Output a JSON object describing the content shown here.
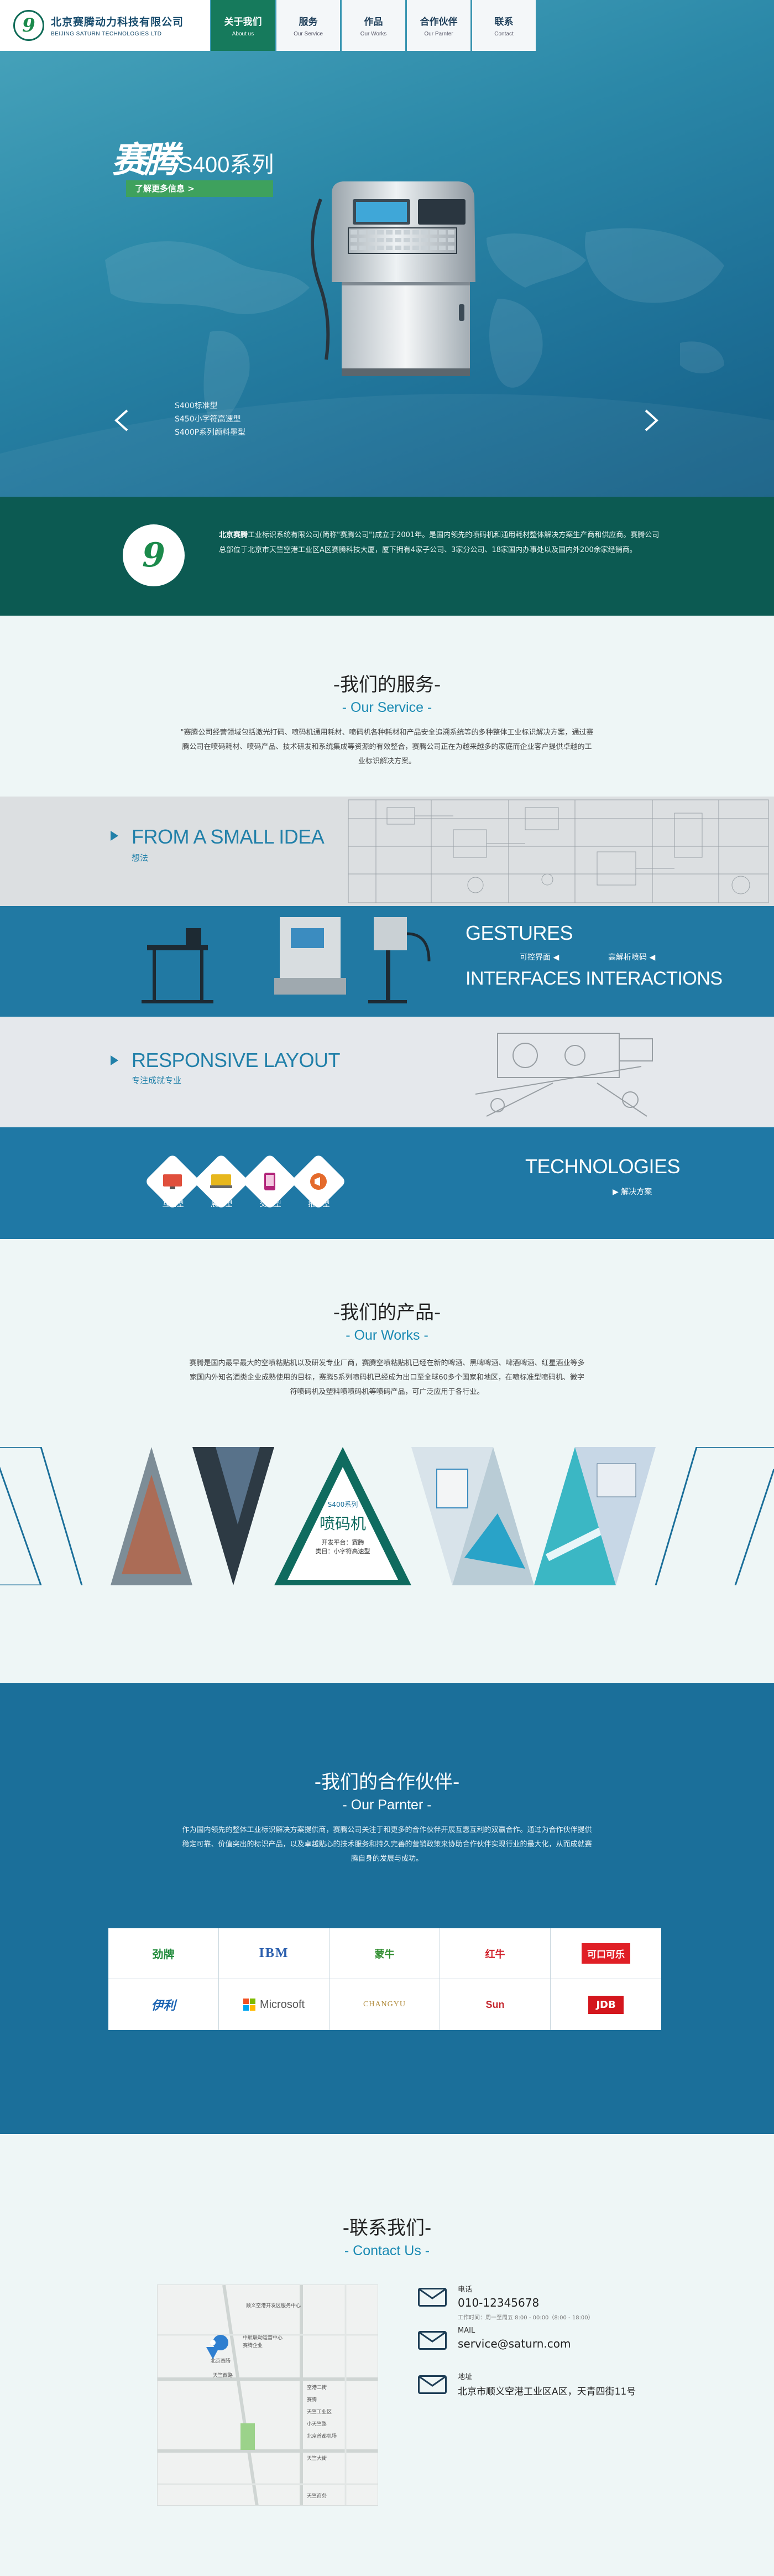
{
  "header": {
    "company_cn": "北京赛腾动力科技有限公司",
    "company_en": "BEIJING SATURN TECHNOLOGIES LTD",
    "nav": [
      {
        "cn": "关于我们",
        "en": "About us",
        "active": true
      },
      {
        "cn": "服务",
        "en": "Our Service",
        "active": false
      },
      {
        "cn": "作品",
        "en": "Our Works",
        "active": false
      },
      {
        "cn": "合作伙伴",
        "en": "Our Parnter",
        "active": false
      },
      {
        "cn": "联系",
        "en": "Contact",
        "active": false
      }
    ]
  },
  "hero": {
    "brand": "赛腾",
    "model": "S400系列",
    "button": "了解更多信息 >",
    "list": [
      "S400标准型",
      "S450小字符高速型",
      "S400P系列颜料墨型"
    ]
  },
  "intro": {
    "lead": "北京赛腾",
    "text": "工业标识系统有限公司(简称\"赛腾公司\")成立于2001年。是国内领先的喷码机和通用耗材整体解决方案生产商和供应商。赛腾公司总部位于北京市天竺空港工业区A区赛腾科技大厦，厦下拥有4家子公司、3家分公司、18家国内办事处以及国内外200余家经销商。"
  },
  "service": {
    "title_cn": "我们的服务",
    "title_en": "Our Service",
    "desc": "\"赛腾公司经营领域包括激光打码、喷码机通用耗材、喷码机各种耗材和产品安全追溯系统等的多种整体工业标识解决方案，通过赛腾公司在喷码耗材、喷码产品、技术研发和系统集成等资源的有效整合，赛腾公司正在为越来越多的家庭而企业客户提供卓越的工业标识解决方案。",
    "stripe1": {
      "head": "FROM A SMALL IDEA",
      "sub": "想法"
    },
    "stripe2": {
      "head1": "GESTURES",
      "head2": "INTERFACES INTERACTIONS",
      "tag1": "可控界面",
      "tag2": "高解析喷码"
    },
    "stripe3": {
      "head": "RESPONSIVE LAYOUT",
      "sub": "专注成就专业"
    },
    "stripe4": {
      "head": "TECHNOLOGIES",
      "sub": "解决方案",
      "icons": [
        {
          "label": "互动型",
          "icon": "display-icon",
          "color": "#e04f3c"
        },
        {
          "label": "展示型",
          "icon": "monitor-icon",
          "color": "#e7b71d"
        },
        {
          "label": "交互型",
          "icon": "phone-icon",
          "color": "#b2247a"
        },
        {
          "label": "推广型",
          "icon": "megaphone-icon",
          "color": "#e46a2b"
        }
      ]
    }
  },
  "works": {
    "title_cn": "我们的产品",
    "title_en": "Our Works",
    "desc": "赛腾是国内最早最大的空喷粘贴机以及研发专业厂商，赛腾空喷粘贴机已经在新的啤酒、黑啤啤酒、啤酒啤酒、红星酒业等多家国内外知名酒类企业成熟使用的目标，赛腾S系列喷码机已经成为出口至全球60多个国家和地区，在喷标准型喷码机、微字符喷码机及塑料喷喷码机等喷码产品，可广泛应用于各行业。",
    "feature": {
      "series": "S400系列",
      "name": "喷码机",
      "line1": "开发平台：赛腾",
      "line2": "类目：小字符高速型"
    }
  },
  "partners": {
    "title_cn": "我们的合作伙伴",
    "title_en": "Our Parnter",
    "desc": "作为国内领先的整体工业标识解决方案提供商，赛腾公司关注于和更多的合作伙伴开展互惠互利的双赢合作。通过为合作伙伴提供稳定可靠、价值突出的标识产品，以及卓越贴心的技术服务和持久完善的营销政策来协助合作伙伴实现行业的最大化，从而成就赛腾自身的发展与成功。",
    "logos": [
      {
        "name": "劲牌",
        "color": "#1f8a3a"
      },
      {
        "name": "IBM",
        "color": "#2b5fae"
      },
      {
        "name": "蒙牛",
        "color": "#2f8d2e"
      },
      {
        "name": "红牛",
        "color": "#d2202a"
      },
      {
        "name": "可口可乐",
        "color": "#e01f26"
      },
      {
        "name": "伊利",
        "color": "#1a63b2"
      },
      {
        "name": "Microsoft",
        "color": "#555555"
      },
      {
        "name": "CHANGYU",
        "color": "#b08a3a"
      },
      {
        "name": "Sun",
        "color": "#c4272e"
      },
      {
        "name": "JDB",
        "color": "#d4161d"
      }
    ]
  },
  "contact": {
    "title_cn": "联系我们",
    "title_en": "Contact Us",
    "phone_label": "电话",
    "phone": "010-12345678",
    "phone_note": "工作时间：周一至周五 8:00 - 00:00（8:00 - 18:00）",
    "mail_label": "MAIL",
    "mail": "service@saturn.com",
    "addr_label": "地址",
    "addr": "北京市顺义空港工业区A区，天青四街11号",
    "map_labels": [
      "顺义空港开发区服务中心",
      "中航联动运营中心",
      "赛腾企业",
      "北京赛腾",
      "空港二街",
      "赛腾",
      "天竺西路",
      "天竺工业区",
      "小天竺路",
      "北京首都机场",
      "天竺大街",
      "天竺商务"
    ]
  }
}
